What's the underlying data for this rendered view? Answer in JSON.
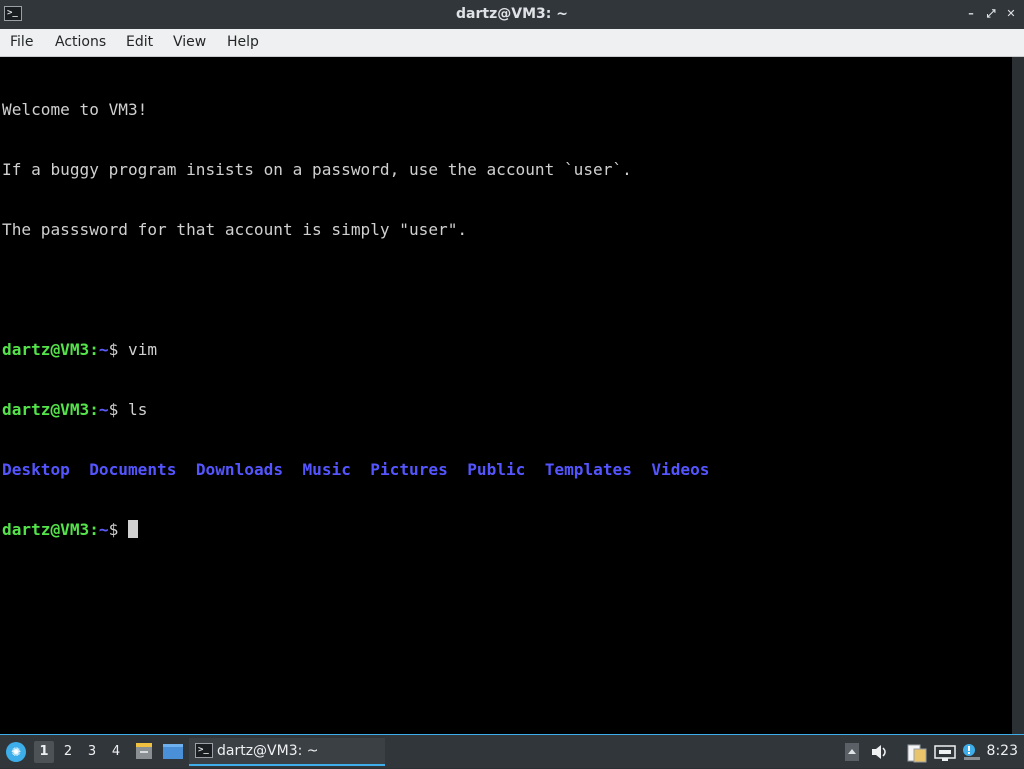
{
  "window": {
    "title": "dartz@VM3: ~",
    "app_icon": "terminal-icon",
    "app_icon_glyph": ">_",
    "controls": {
      "minimize_glyph": "–",
      "maximize_glyph": "⤢",
      "close_glyph": "✕"
    }
  },
  "menubar": {
    "items": [
      "File",
      "Actions",
      "Edit",
      "View",
      "Help"
    ]
  },
  "terminal": {
    "lines": [
      "Welcome to VM3!",
      "If a buggy program insists on a password, use the account `user`.",
      "The passsword for that account is simply \"user\"."
    ],
    "prompt_user": "dartz@VM3",
    "prompt_sep": ":",
    "prompt_dir": "~",
    "prompt_sign": "$ ",
    "commands": [
      "vim",
      "ls"
    ],
    "ls_output": [
      "Desktop",
      "Documents",
      "Downloads",
      "Music",
      "Pictures",
      "Public",
      "Templates",
      "Videos"
    ],
    "colors": {
      "prompt_user": "#54e34a",
      "directory": "#5555ff",
      "text": "#d0d0d0",
      "background": "#000000"
    }
  },
  "taskbar": {
    "start_icon": "lxqt-start-icon",
    "desktops": [
      "1",
      "2",
      "3",
      "4"
    ],
    "active_desktop": "1",
    "task_label": "dartz@VM3: ~",
    "clock": "8:23",
    "accent": "#3daee9"
  }
}
